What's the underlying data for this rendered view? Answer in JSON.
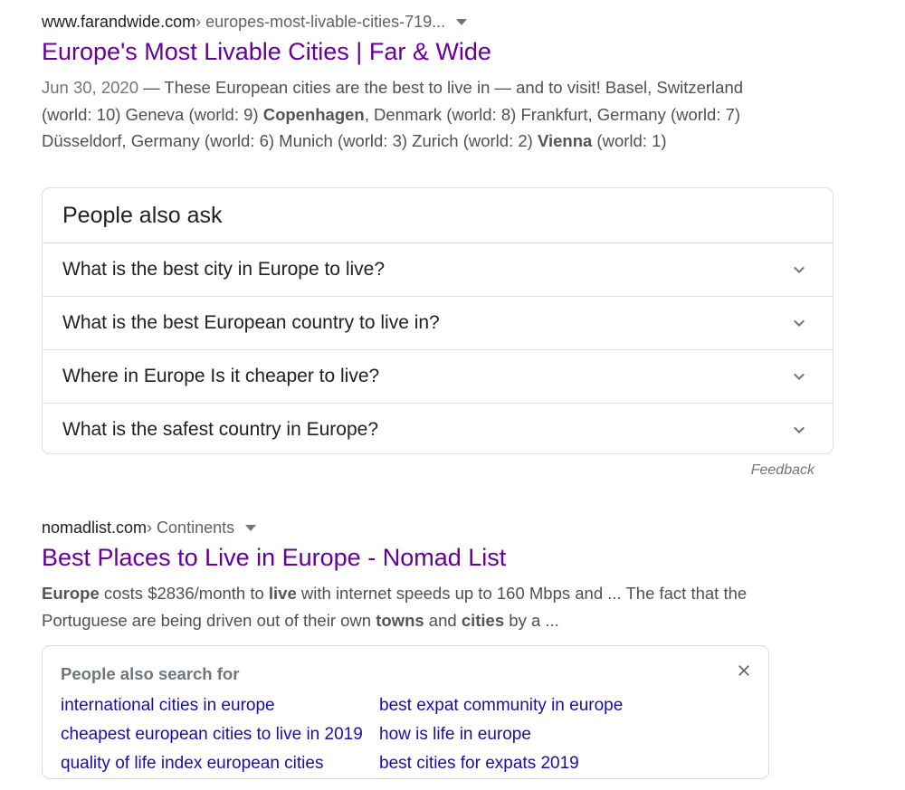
{
  "result1": {
    "domain": "www.farandwide.com",
    "path": " › europes-most-livable-cities-719...",
    "title": "Europe's Most Livable Cities | Far & Wide",
    "date": "Jun 30, 2020",
    "snippet_parts": [
      {
        "t": " — These European cities are the best to live in — and to visit! Basel, Switzerland (world: 10) Geneva (world: 9) ",
        "b": false
      },
      {
        "t": "Copenhagen",
        "b": true
      },
      {
        "t": ", Denmark (world: 8) Frankfurt, Germany (world: 7) Düsseldorf, Germany (world: 6) Munich (world: 3) Zurich (world: 2) ",
        "b": false
      },
      {
        "t": "Vienna",
        "b": true
      },
      {
        "t": " (world: 1)",
        "b": false
      }
    ]
  },
  "people_also_ask": {
    "title": "People also ask",
    "questions": [
      "What is the best city in Europe to live?",
      "What is the best European country to live in?",
      "Where in Europe Is it cheaper to live?",
      "What is the safest country in Europe?"
    ],
    "feedback_label": "Feedback"
  },
  "result2": {
    "domain": "nomadlist.com",
    "path": " › Continents",
    "title": "Best Places to Live in Europe - Nomad List",
    "snippet_parts": [
      {
        "t": "Europe",
        "b": true
      },
      {
        "t": " costs $2836/month to ",
        "b": false
      },
      {
        "t": "live",
        "b": true
      },
      {
        "t": " with internet speeds up to 160 Mbps and ... The fact that the Portuguese are being driven out of their own ",
        "b": false
      },
      {
        "t": "towns",
        "b": true
      },
      {
        "t": " and ",
        "b": false
      },
      {
        "t": "cities",
        "b": true
      },
      {
        "t": " by a ...",
        "b": false
      }
    ]
  },
  "people_also_search_for": {
    "title": "People also search for",
    "left_links": [
      "international cities in europe",
      "cheapest european cities to live in 2019",
      "quality of life index european cities"
    ],
    "right_links": [
      "best expat community in europe",
      "how is life in europe",
      "best cities for expats 2019"
    ]
  },
  "colors": {
    "visited_link": "#660099",
    "link": "#1a0dab",
    "snippet_text": "#4d5156",
    "border": "#dadce0"
  },
  "icons": {
    "expand": "chevron-down-icon",
    "dismiss": "close-icon",
    "menu": "caret-down-icon"
  }
}
